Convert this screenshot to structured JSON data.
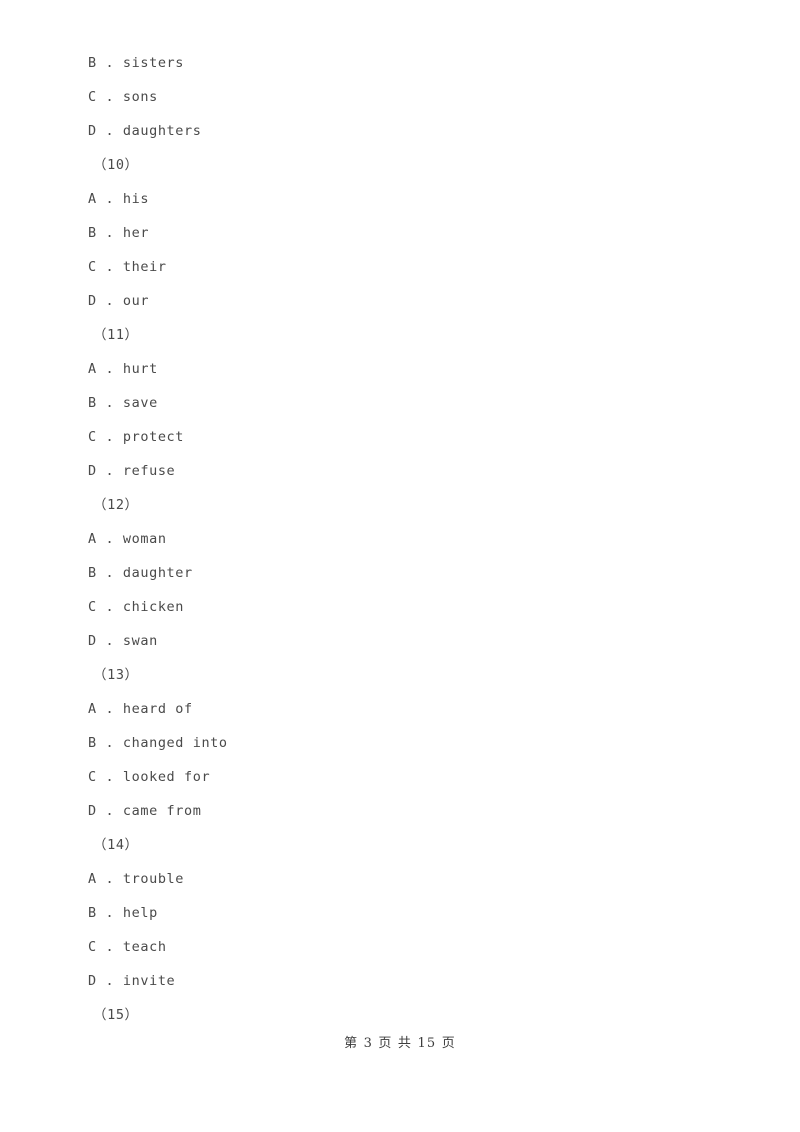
{
  "document": {
    "kind": "exam-paper-cloze-options",
    "page_background": "#ffffff",
    "text_color": "#4a4a4a",
    "footer_color": "#3d3d3d"
  },
  "body_lines": [
    {
      "type": "option",
      "text": "B . sisters"
    },
    {
      "type": "option",
      "text": "C . sons"
    },
    {
      "type": "option",
      "text": "D . daughters"
    },
    {
      "type": "number",
      "text": "（10）"
    },
    {
      "type": "option",
      "text": "A . his"
    },
    {
      "type": "option",
      "text": "B . her"
    },
    {
      "type": "option",
      "text": "C . their"
    },
    {
      "type": "option",
      "text": "D . our"
    },
    {
      "type": "number",
      "text": "（11）"
    },
    {
      "type": "option",
      "text": "A . hurt"
    },
    {
      "type": "option",
      "text": "B . save"
    },
    {
      "type": "option",
      "text": "C . protect"
    },
    {
      "type": "option",
      "text": "D . refuse"
    },
    {
      "type": "number",
      "text": "（12）"
    },
    {
      "type": "option",
      "text": "A . woman"
    },
    {
      "type": "option",
      "text": "B . daughter"
    },
    {
      "type": "option",
      "text": "C . chicken"
    },
    {
      "type": "option",
      "text": "D . swan"
    },
    {
      "type": "number",
      "text": "（13）"
    },
    {
      "type": "option",
      "text": "A . heard of"
    },
    {
      "type": "option",
      "text": "B . changed into"
    },
    {
      "type": "option",
      "text": "C . looked for"
    },
    {
      "type": "option",
      "text": "D . came from"
    },
    {
      "type": "number",
      "text": "（14）"
    },
    {
      "type": "option",
      "text": "A . trouble"
    },
    {
      "type": "option",
      "text": "B . help"
    },
    {
      "type": "option",
      "text": "C . teach"
    },
    {
      "type": "option",
      "text": "D . invite"
    },
    {
      "type": "number",
      "text": "（15）"
    }
  ],
  "footer": {
    "text": "第 3 页 共 15 页",
    "current_page": "3",
    "total_pages": "15"
  }
}
